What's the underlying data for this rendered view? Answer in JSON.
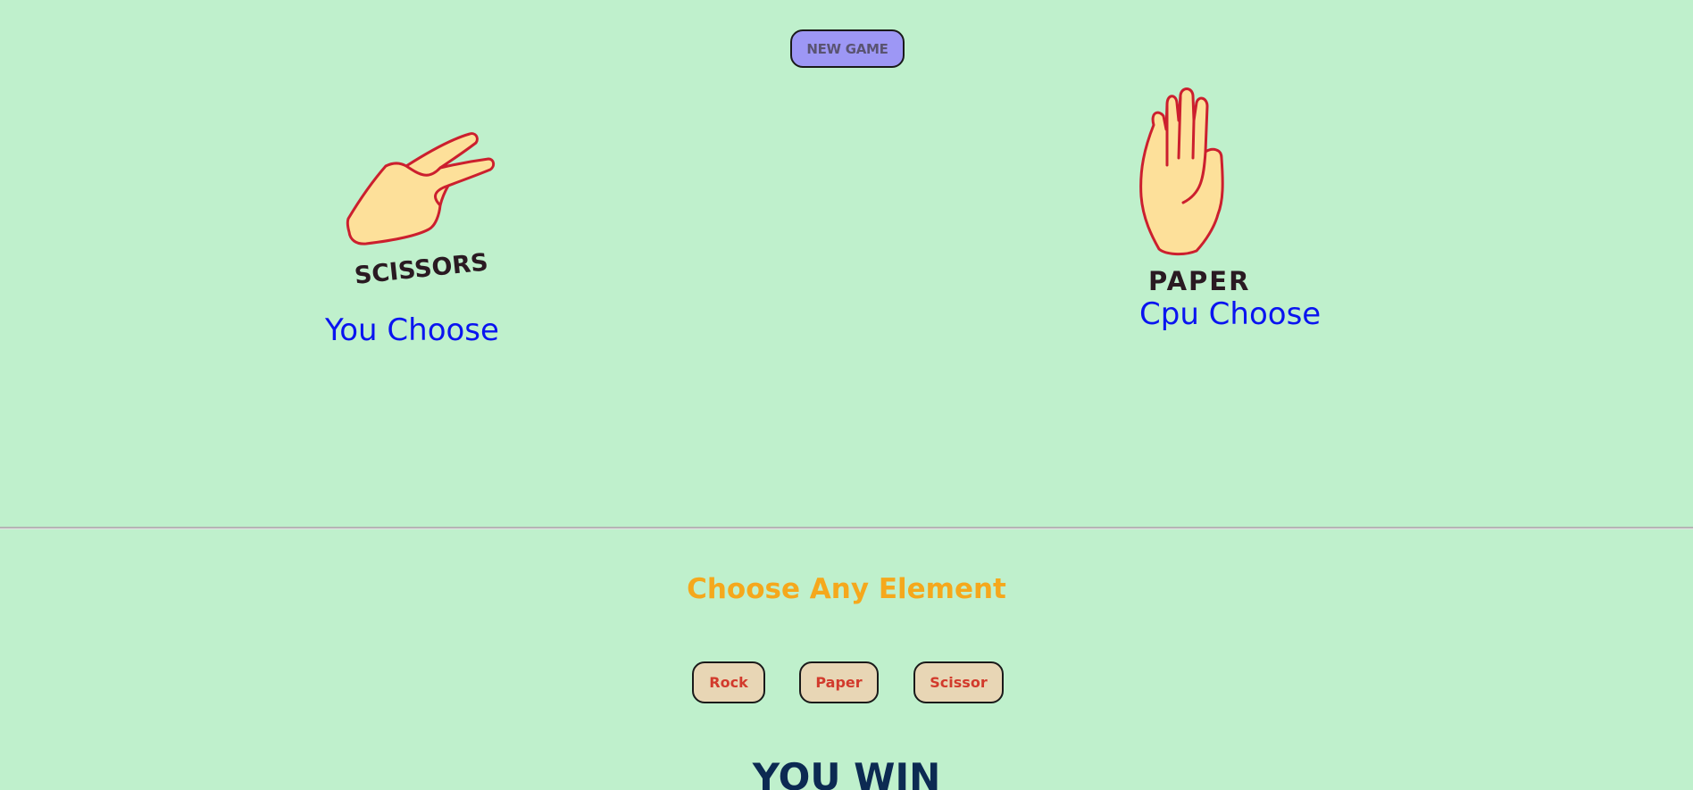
{
  "controls": {
    "new_game_label": "NEW GAME"
  },
  "player": {
    "choice": "scissors",
    "image_label": "SCISSORS",
    "caption": "You Choose"
  },
  "cpu": {
    "choice": "paper",
    "image_label": "PAPER",
    "caption": "Cpu Choose"
  },
  "chooser": {
    "title": "Choose Any Element",
    "options": [
      "Rock",
      "Paper",
      "Scissor"
    ]
  },
  "result": {
    "text": "YOU WIN"
  },
  "colors": {
    "background": "#bff0cc",
    "new_game_button": "#9d97f5",
    "choice_button": "#e8d6b5",
    "choice_text": "#d23a2c",
    "caption_text": "#0a14f0",
    "prompt_text": "#f5a81c",
    "result_text": "#0c2a52",
    "hand_fill": "#fde09a",
    "hand_outline": "#cc1f2e"
  }
}
